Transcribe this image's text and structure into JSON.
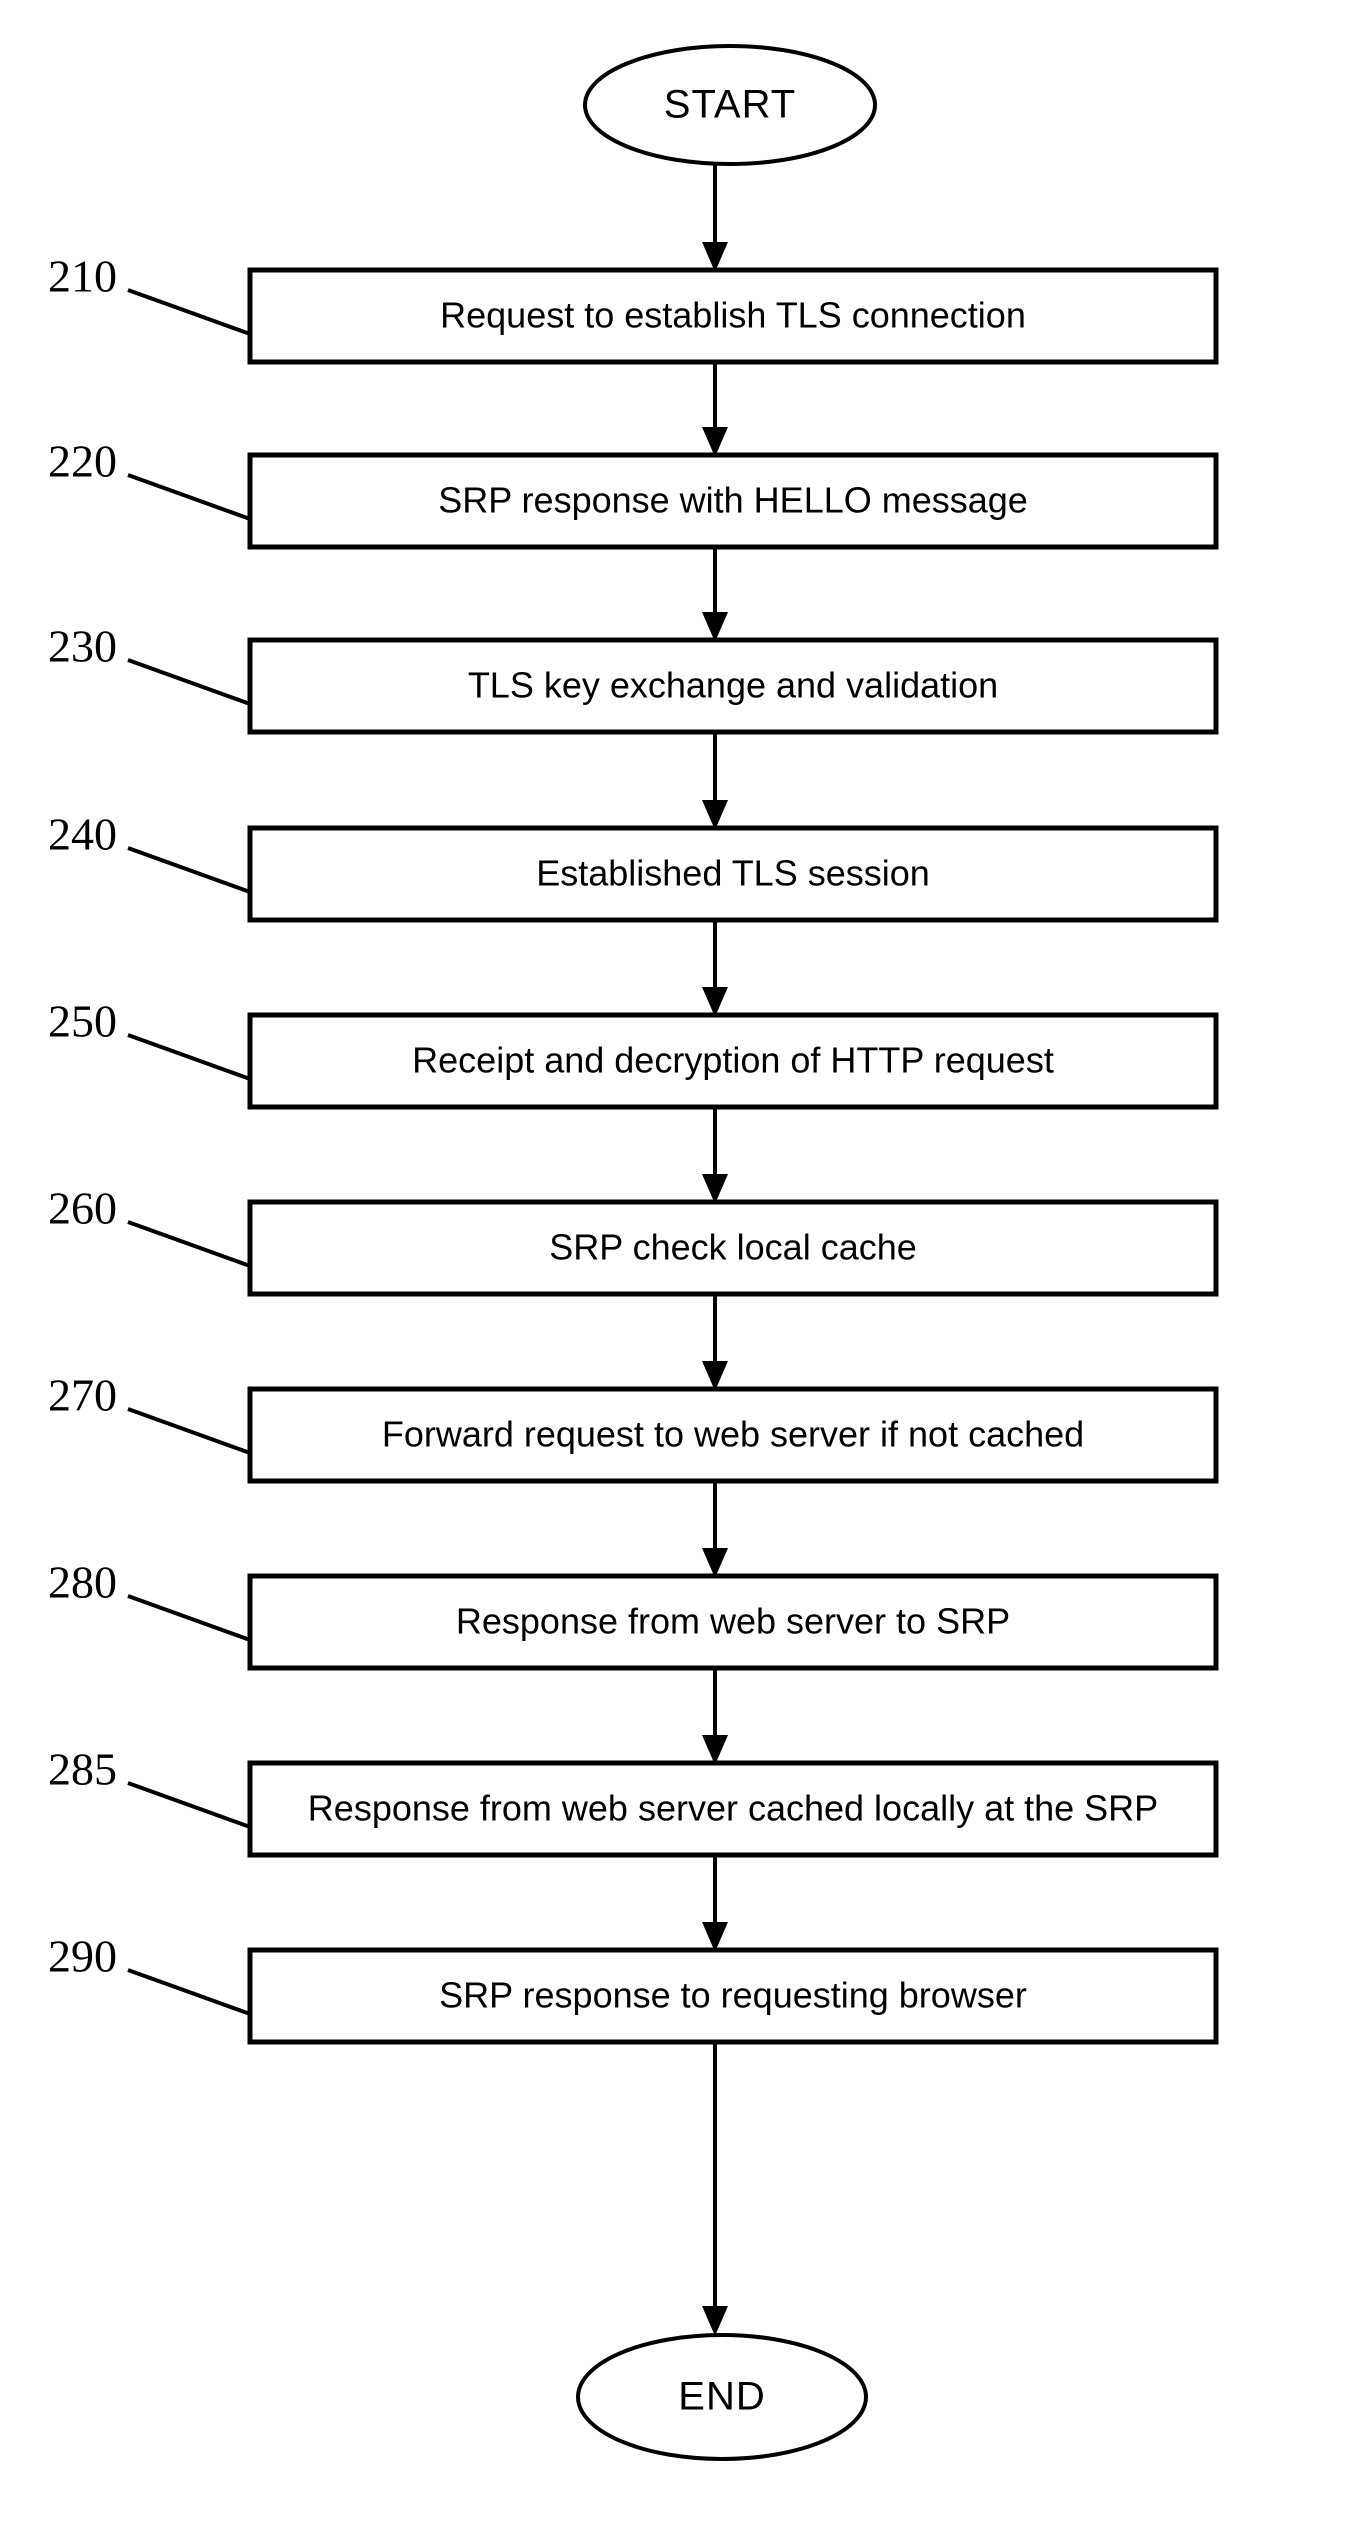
{
  "diagram": {
    "type": "flowchart",
    "orientation": "vertical",
    "start_label": "START",
    "end_label": "END",
    "steps": [
      {
        "ref": "210",
        "label": "Request to establish TLS connection"
      },
      {
        "ref": "220",
        "label": "SRP response with HELLO message"
      },
      {
        "ref": "230",
        "label": "TLS key exchange and validation"
      },
      {
        "ref": "240",
        "label": "Established TLS session"
      },
      {
        "ref": "250",
        "label": "Receipt and decryption of HTTP request"
      },
      {
        "ref": "260",
        "label": "SRP check local cache"
      },
      {
        "ref": "270",
        "label": "Forward request to web server if not cached"
      },
      {
        "ref": "280",
        "label": "Response from web server to SRP"
      },
      {
        "ref": "285",
        "label": "Response from web server cached locally at the SRP"
      },
      {
        "ref": "290",
        "label": "SRP response to requesting browser"
      }
    ],
    "colors": {
      "stroke": "#000000",
      "fill": "#ffffff",
      "text": "#000000"
    }
  }
}
